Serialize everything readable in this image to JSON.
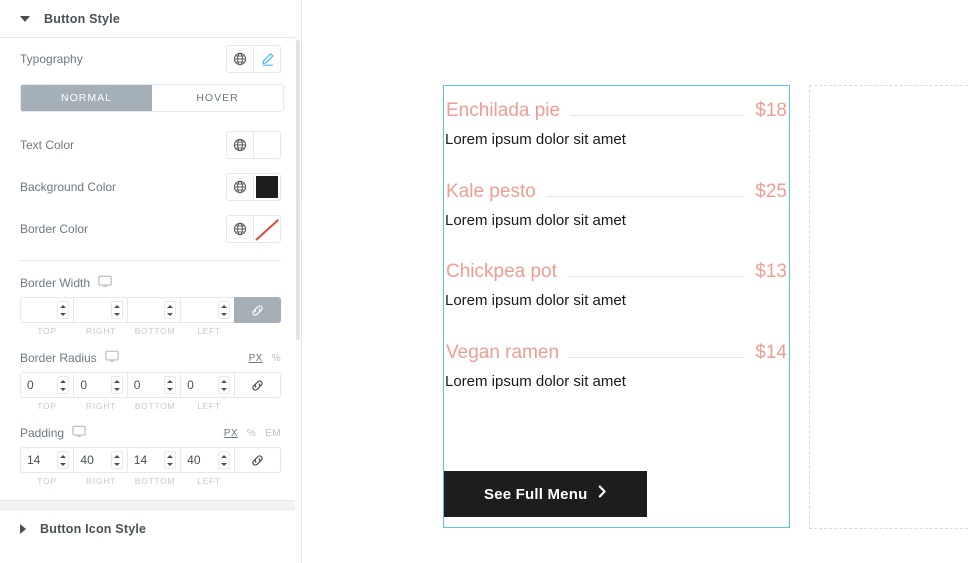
{
  "panel": {
    "section_title": "Button Style",
    "typography": {
      "label": "Typography",
      "globe_icon": "globe-icon",
      "edit_icon": "pencil-icon"
    },
    "state_tabs": [
      {
        "label": "NORMAL",
        "active": true
      },
      {
        "label": "HOVER",
        "active": false
      }
    ],
    "colors": [
      {
        "label": "Text Color",
        "value": "",
        "swatch": "#ffffff",
        "kind": "empty"
      },
      {
        "label": "Background Color",
        "value": "#1d1d1d",
        "swatch": "#1d1d1d",
        "kind": "solid"
      },
      {
        "label": "Border Color",
        "value": "",
        "swatch": "",
        "kind": "none"
      }
    ],
    "border_width": {
      "label": "Border Width",
      "device_icon": "desktop-icon",
      "values": [
        "",
        "",
        "",
        ""
      ],
      "sides": [
        "TOP",
        "RIGHT",
        "BOTTOM",
        "LEFT"
      ],
      "linked": true,
      "units": []
    },
    "border_radius": {
      "label": "Border Radius",
      "device_icon": "desktop-icon",
      "values": [
        "0",
        "0",
        "0",
        "0"
      ],
      "sides": [
        "TOP",
        "RIGHT",
        "BOTTOM",
        "LEFT"
      ],
      "linked": false,
      "units": [
        {
          "label": "PX",
          "active": true
        },
        {
          "label": "%",
          "active": false
        }
      ]
    },
    "padding": {
      "label": "Padding",
      "device_icon": "desktop-icon",
      "values": [
        "14",
        "40",
        "14",
        "40"
      ],
      "sides": [
        "TOP",
        "RIGHT",
        "BOTTOM",
        "LEFT"
      ],
      "linked": false,
      "units": [
        {
          "label": "PX",
          "active": true
        },
        {
          "label": "%",
          "active": false
        },
        {
          "label": "EM",
          "active": false
        }
      ]
    },
    "next_section_title": "Button Icon Style"
  },
  "collapse_handle": {
    "icon": "chevron-left-icon"
  },
  "canvas": {
    "selected_column": {
      "menu_items": [
        {
          "title": "Enchilada pie",
          "price": "$18",
          "description": "Lorem ipsum dolor sit amet"
        },
        {
          "title": "Kale pesto",
          "price": "$25",
          "description": "Lorem ipsum dolor sit amet"
        },
        {
          "title": "Chickpea pot",
          "price": "$13",
          "description": "Lorem ipsum dolor sit amet"
        },
        {
          "title": "Vegan ramen",
          "price": "$14",
          "description": "Lorem ipsum dolor sit amet"
        }
      ],
      "cta": {
        "label": "See Full Menu",
        "icon": "chevron-right-icon"
      }
    },
    "empty_column": {
      "label": ""
    }
  },
  "theme": {
    "accent_pink": "#ef9c93",
    "selection_blue": "#59c3f0",
    "button_bg": "#1d1d1d",
    "tab_active_bg": "#a4afb7",
    "panel_label": "#6d7882"
  }
}
